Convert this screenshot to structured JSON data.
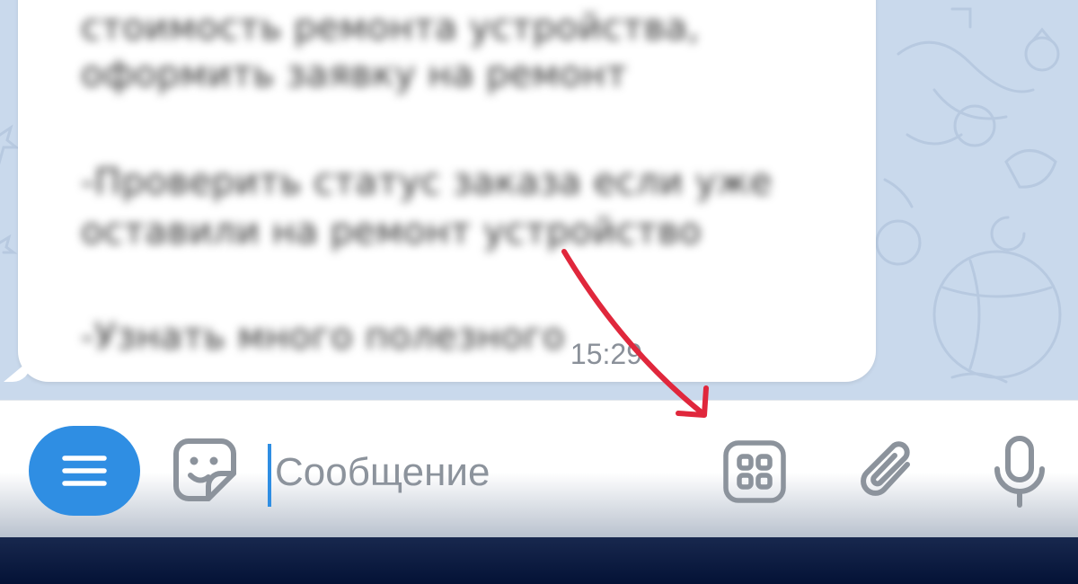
{
  "chat": {
    "message": {
      "lines": [
        "стоимость ремонта устройства,",
        "оформить заявку на ремонт",
        "-Проверить статус заказа если уже",
        "оставили на ремонт устройство",
        "-Узнать много полезного"
      ],
      "time": "15:29"
    }
  },
  "input_bar": {
    "menu_button": {
      "icon": "hamburger-menu-icon"
    },
    "sticker_button": {
      "icon": "sticker-smile-icon"
    },
    "message_input": {
      "placeholder": "Сообщение",
      "value": ""
    },
    "apps_button": {
      "icon": "grid-apps-icon"
    },
    "attach_button": {
      "icon": "paperclip-icon"
    },
    "mic_button": {
      "icon": "microphone-icon"
    }
  },
  "colors": {
    "chat_background": "#c9d9ec",
    "accent": "#2f8ee3",
    "icon_gray": "#8c939c",
    "annotation_arrow": "#e0273c",
    "bottom_band": "#041236"
  }
}
